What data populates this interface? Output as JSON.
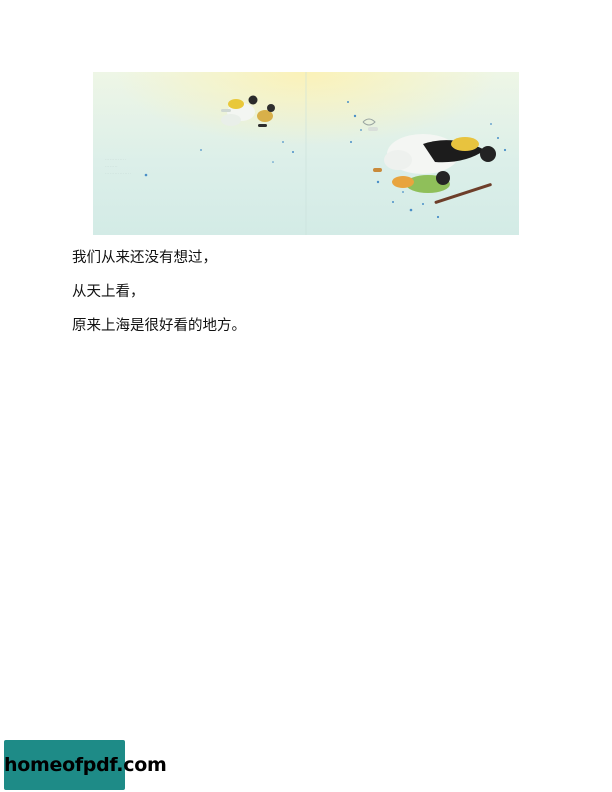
{
  "illustration": {
    "caption_lines": [
      "· · · · · · · · · · · · ·",
      "· · · · · · · ·",
      "· · · · · · · · · · · · · · · ·"
    ]
  },
  "body_text": {
    "line_1": "我们从来还没有想过，",
    "line_2": "从天上看，",
    "line_3": "原来上海是很好看的地方。"
  },
  "watermark": {
    "label": "homeofpdf.com",
    "color": "#1e8b87"
  }
}
